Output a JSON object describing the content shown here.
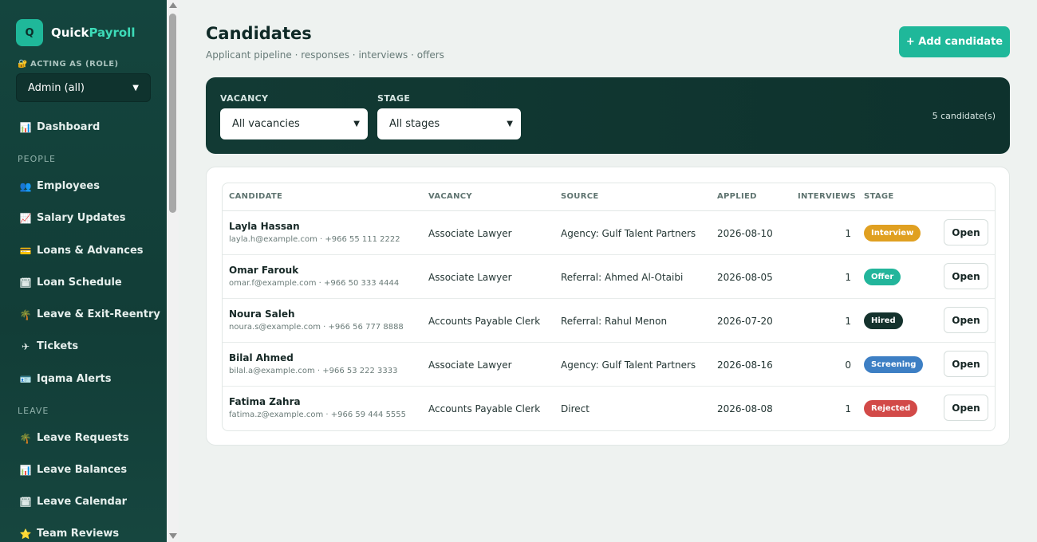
{
  "app": {
    "logo_letter": "Q",
    "name_part1": "Quick",
    "name_part2": "Payroll"
  },
  "role": {
    "label": "ACTING AS (ROLE)",
    "value": "Admin (all)"
  },
  "nav": {
    "dashboard": "Dashboard",
    "section_people": "PEOPLE",
    "employees": "Employees",
    "salary_updates": "Salary Updates",
    "loans_advances": "Loans & Advances",
    "loan_schedule": "Loan Schedule",
    "leave_exit": "Leave & Exit-Reentry",
    "tickets": "Tickets",
    "iqama_alerts": "Iqama Alerts",
    "section_leave": "LEAVE",
    "leave_requests": "Leave Requests",
    "leave_balances": "Leave Balances",
    "leave_calendar": "Leave Calendar",
    "team_reviews": "Team Reviews"
  },
  "page": {
    "title": "Candidates",
    "subtitle": "Applicant pipeline · responses · interviews · offers",
    "add_button": "+ Add candidate"
  },
  "filters": {
    "vacancy_label": "VACANCY",
    "vacancy_value": "All vacancies",
    "stage_label": "STAGE",
    "stage_value": "All stages",
    "count_text": "5 candidate(s)"
  },
  "table": {
    "headers": {
      "candidate": "CANDIDATE",
      "vacancy": "VACANCY",
      "source": "SOURCE",
      "applied": "APPLIED",
      "interviews": "INTERVIEWS",
      "stage": "STAGE"
    },
    "open_label": "Open",
    "rows": [
      {
        "name": "Layla Hassan",
        "contact": "layla.h@example.com · +966 55 111 2222",
        "vacancy": "Associate Lawyer",
        "source": "Agency: Gulf Talent Partners",
        "applied": "2026-08-10",
        "interviews": "1",
        "stage": "Interview",
        "stage_color": "#e0a021"
      },
      {
        "name": "Omar Farouk",
        "contact": "omar.f@example.com · +966 50 333 4444",
        "vacancy": "Associate Lawyer",
        "source": "Referral: Ahmed Al-Otaibi",
        "applied": "2026-08-05",
        "interviews": "1",
        "stage": "Offer",
        "stage_color": "#22b59b"
      },
      {
        "name": "Noura Saleh",
        "contact": "noura.s@example.com · +966 56 777 8888",
        "vacancy": "Accounts Payable Clerk",
        "source": "Referral: Rahul Menon",
        "applied": "2026-07-20",
        "interviews": "1",
        "stage": "Hired",
        "stage_color": "#14322d"
      },
      {
        "name": "Bilal Ahmed",
        "contact": "bilal.a@example.com · +966 53 222 3333",
        "vacancy": "Associate Lawyer",
        "source": "Agency: Gulf Talent Partners",
        "applied": "2026-08-16",
        "interviews": "0",
        "stage": "Screening",
        "stage_color": "#3d7fc4"
      },
      {
        "name": "Fatima Zahra",
        "contact": "fatima.z@example.com · +966 59 444 5555",
        "vacancy": "Accounts Payable Clerk",
        "source": "Direct",
        "applied": "2026-08-08",
        "interviews": "1",
        "stage": "Rejected",
        "stage_color": "#d24a48"
      }
    ]
  },
  "colors": {
    "brand": "#1fb89a",
    "sidebar": "#14453e",
    "filter_bar": "#123a34"
  },
  "icons": {
    "dashboard": "bar-chart-icon",
    "employees": "people-icon",
    "salary": "trend-chart-icon",
    "loans": "credit-card-icon",
    "schedule": "calendar-icon",
    "leave": "palm-tree-icon",
    "tickets": "airplane-icon",
    "iqama": "id-card-icon",
    "reviews": "star-icon"
  }
}
